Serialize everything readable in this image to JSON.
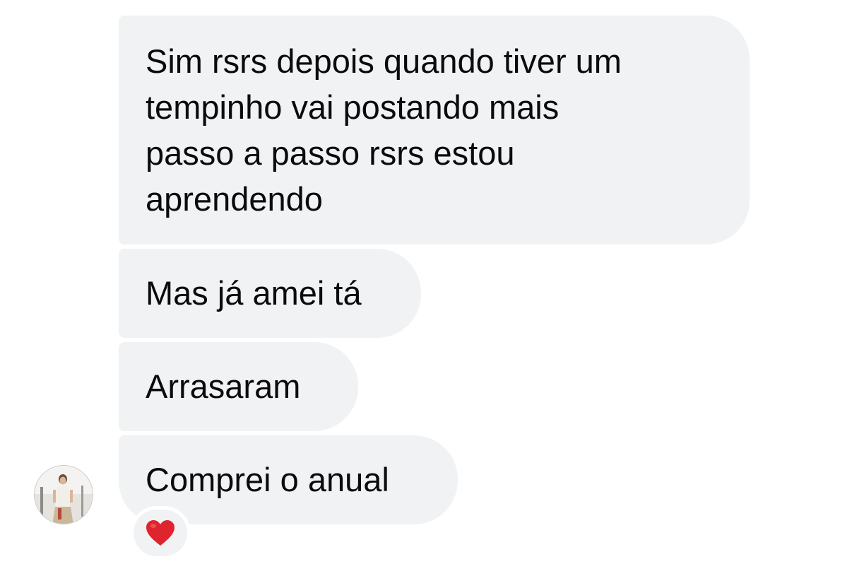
{
  "conversation": {
    "messages": [
      {
        "text": "Sim rsrs depois quando tiver um\ntempinho vai postando mais\npasso a passo rsrs estou\naprendendo"
      },
      {
        "text": "Mas já amei tá"
      },
      {
        "text": "Arrasaram"
      },
      {
        "text": "Comprei o anual"
      }
    ],
    "sender_avatar_icon": "avatar-photo",
    "reaction": {
      "icon": "heart-icon",
      "color": "#e0242e"
    },
    "colors": {
      "bubble_background": "#f1f2f4",
      "text": "#0b0b0d",
      "page_background": "#ffffff"
    }
  }
}
